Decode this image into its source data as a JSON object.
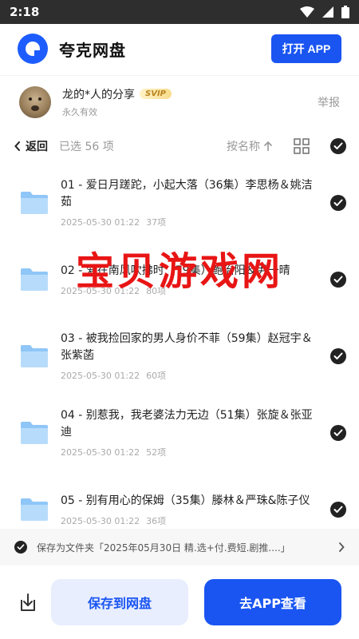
{
  "status_bar": {
    "time": "2:18"
  },
  "header": {
    "app_title": "夸克网盘",
    "open_app_label": "打开 APP"
  },
  "share": {
    "name": "龙的*人的分享",
    "badge": "SVIP",
    "validity": "永久有效",
    "report_label": "举报"
  },
  "toolbar": {
    "back_label": "返回",
    "selected_count": "已选 56 项",
    "sort_label": "按名称"
  },
  "files": [
    {
      "name": "01 - 爱日月蹉跎，小起大落（36集）李思杨＆姚洁茹",
      "date": "2025-05-30 01:22",
      "count": "37项"
    },
    {
      "name": "02 - 爱在南风吹拂时（79集）鲍治阳＆尹一晴",
      "date": "2025-05-30 01:22",
      "count": "80项"
    },
    {
      "name": "03 - 被我捡回家的男人身价不菲（59集）赵冠宇＆张紫菡",
      "date": "2025-05-30 01:22",
      "count": "60项"
    },
    {
      "name": "04 - 别惹我，我老婆法力无边（51集）张旋＆张亚迪",
      "date": "2025-05-30 01:22",
      "count": "52项"
    },
    {
      "name": "05 - 别有用心的保姆（35集）滕林＆严珠&陈子仪",
      "date": "2025-05-30 01:22",
      "count": "36项"
    }
  ],
  "watermark": "宝贝游戏网",
  "save_folder": {
    "text": "保存为文件夹「2025年05月30日 精.选+付.费短.剧推....」"
  },
  "bottom": {
    "save_label": "保存到网盘",
    "goto_app_label": "去APP查看"
  },
  "colors": {
    "accent": "#1a55f2",
    "watermark": "#e81515",
    "svip": "#b98520"
  }
}
